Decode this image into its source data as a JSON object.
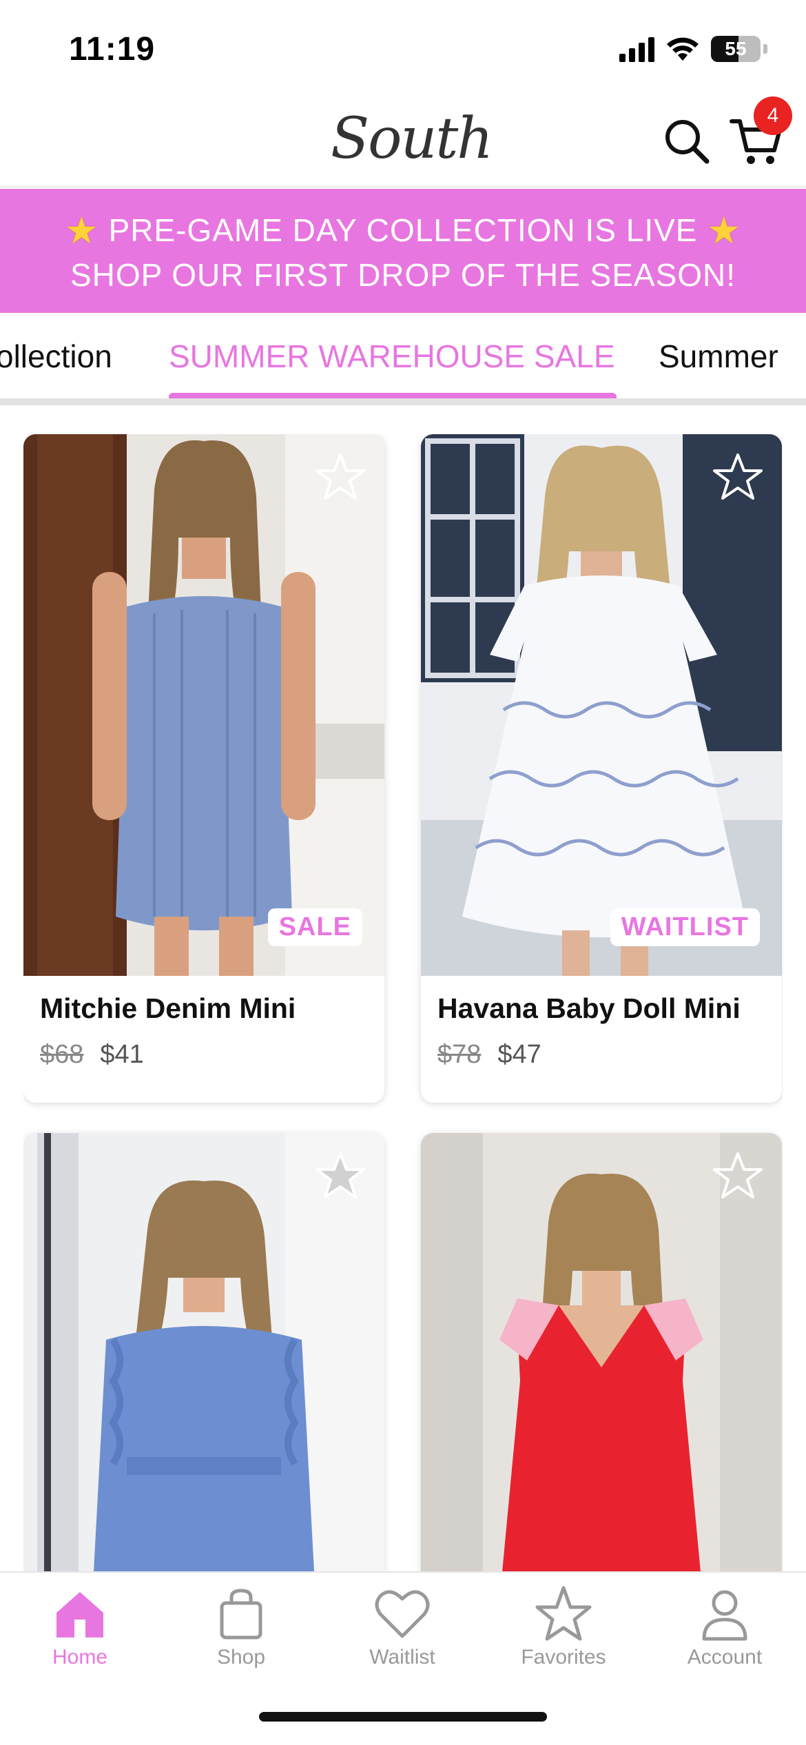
{
  "status_bar": {
    "time": "11:19",
    "battery_level": "55",
    "battery_fraction": 0.55
  },
  "header": {
    "logo_text": "South",
    "cart_count": "4"
  },
  "promo": {
    "line1": "PRE-GAME DAY COLLECTION IS LIVE",
    "line2": "SHOP OUR FIRST DROP OF THE SEASON!",
    "icon": "star-emoji"
  },
  "tabs": [
    {
      "label": "ollection",
      "active": false
    },
    {
      "label": "SUMMER WAREHOUSE SALE",
      "active": true
    },
    {
      "label": "Summer",
      "active": false
    }
  ],
  "products": [
    {
      "name": "Mitchie Denim Mini",
      "old_price": "$68",
      "price": "$41",
      "badge": "SALE",
      "favorited": false
    },
    {
      "name": "Havana Baby Doll Mini",
      "old_price": "$78",
      "price": "$47",
      "badge": "WAITLIST",
      "favorited": false
    },
    {
      "name": "",
      "old_price": "",
      "price": "",
      "badge": "",
      "favorited": false
    },
    {
      "name": "",
      "old_price": "",
      "price": "",
      "badge": "",
      "favorited": false
    }
  ],
  "bottom_nav": [
    {
      "label": "Home",
      "icon": "home-icon",
      "active": true
    },
    {
      "label": "Shop",
      "icon": "shopping-bag-icon",
      "active": false
    },
    {
      "label": "Waitlist",
      "icon": "heart-icon",
      "active": false
    },
    {
      "label": "Favorites",
      "icon": "star-icon",
      "active": false
    },
    {
      "label": "Account",
      "icon": "person-icon",
      "active": false
    }
  ],
  "colors": {
    "accent": "#e876e0",
    "badge_red": "#e92222",
    "inactive_gray": "#999999"
  }
}
